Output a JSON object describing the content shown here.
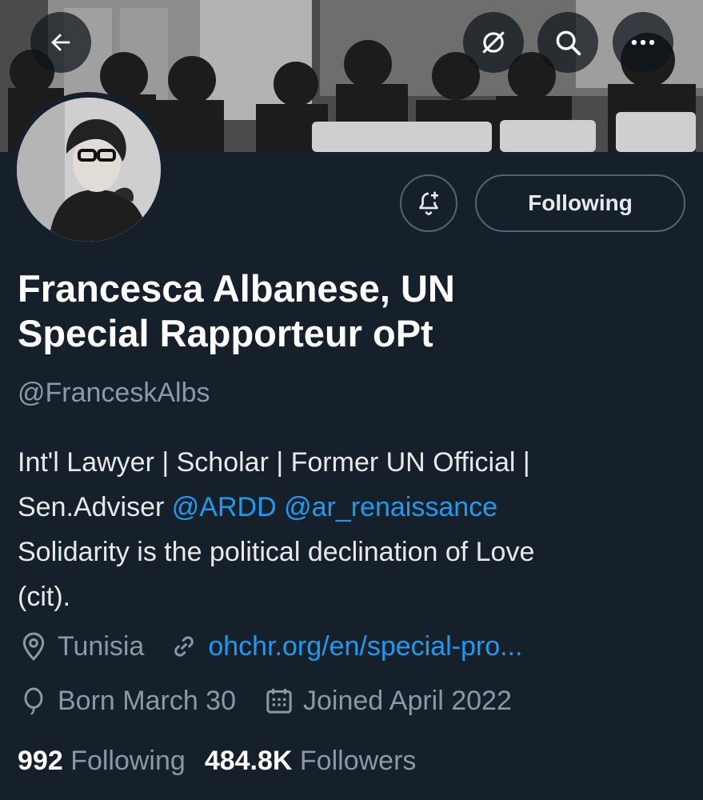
{
  "profile": {
    "name_line1": "Francesca Albanese, UN",
    "name_line2": "Special Rapporteur oPt",
    "handle": "@FranceskAlbs",
    "bio": {
      "line1": "Int'l Lawyer | Scholar | Former UN Official |",
      "line2_prefix": "Sen.Adviser ",
      "mention1": "@ARDD",
      "mention2": "@ar_renaissance",
      "line3": "Solidarity is the political declination of Love",
      "line4": "(cit)."
    },
    "location": "Tunisia",
    "website": "ohchr.org/en/special-pro...",
    "birthday": "Born March 30",
    "joined": "Joined April 2022",
    "following_count": "992",
    "following_label": "Following",
    "followers_count": "484.8K",
    "followers_label": "Followers"
  },
  "actions": {
    "follow_state": "Following"
  },
  "icons": {
    "back": "arrow-left-icon",
    "grok": "grok-icon",
    "search": "search-icon",
    "more": "more-icon",
    "notify": "bell-plus-icon",
    "location": "location-pin-icon",
    "link": "link-icon",
    "birthday": "balloon-icon",
    "calendar": "calendar-icon"
  },
  "colors": {
    "background": "#15202b",
    "accent": "#1d9bf0",
    "secondary_text": "#8b98a5"
  }
}
